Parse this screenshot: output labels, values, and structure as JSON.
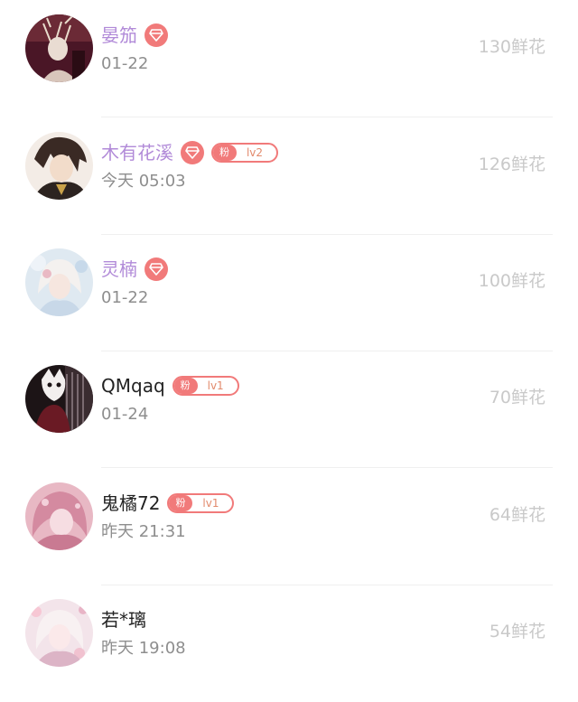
{
  "colors": {
    "vip_name": "#b18ad8",
    "badge": "#f17a7a",
    "meta": "#8e8e8e",
    "flowers": "#c9c9c9"
  },
  "rows": [
    {
      "name": "晏笳",
      "vip": true,
      "fan_badge": null,
      "date": "01-22",
      "flowers": "130鲜花",
      "avatar_icon": "avatar-portrait"
    },
    {
      "name": "木有花溪",
      "vip": true,
      "fan_badge": {
        "tag": "粉",
        "level": "lv2"
      },
      "date": "今天 05:03",
      "flowers": "126鲜花",
      "avatar_icon": "avatar-portrait"
    },
    {
      "name": "灵楠",
      "vip": true,
      "fan_badge": null,
      "date": "01-22",
      "flowers": "100鲜花",
      "avatar_icon": "avatar-portrait"
    },
    {
      "name": "QMqaq",
      "vip": false,
      "fan_badge": {
        "tag": "粉",
        "level": "lv1"
      },
      "date": "01-24",
      "flowers": "70鲜花",
      "avatar_icon": "avatar-portrait"
    },
    {
      "name": "鬼橘72",
      "vip": false,
      "fan_badge": {
        "tag": "粉",
        "level": "lv1"
      },
      "date": "昨天 21:31",
      "flowers": "64鲜花",
      "avatar_icon": "avatar-portrait"
    },
    {
      "name": "若*璃",
      "vip": false,
      "fan_badge": null,
      "date": "昨天 19:08",
      "flowers": "54鲜花",
      "avatar_icon": "avatar-portrait"
    }
  ]
}
